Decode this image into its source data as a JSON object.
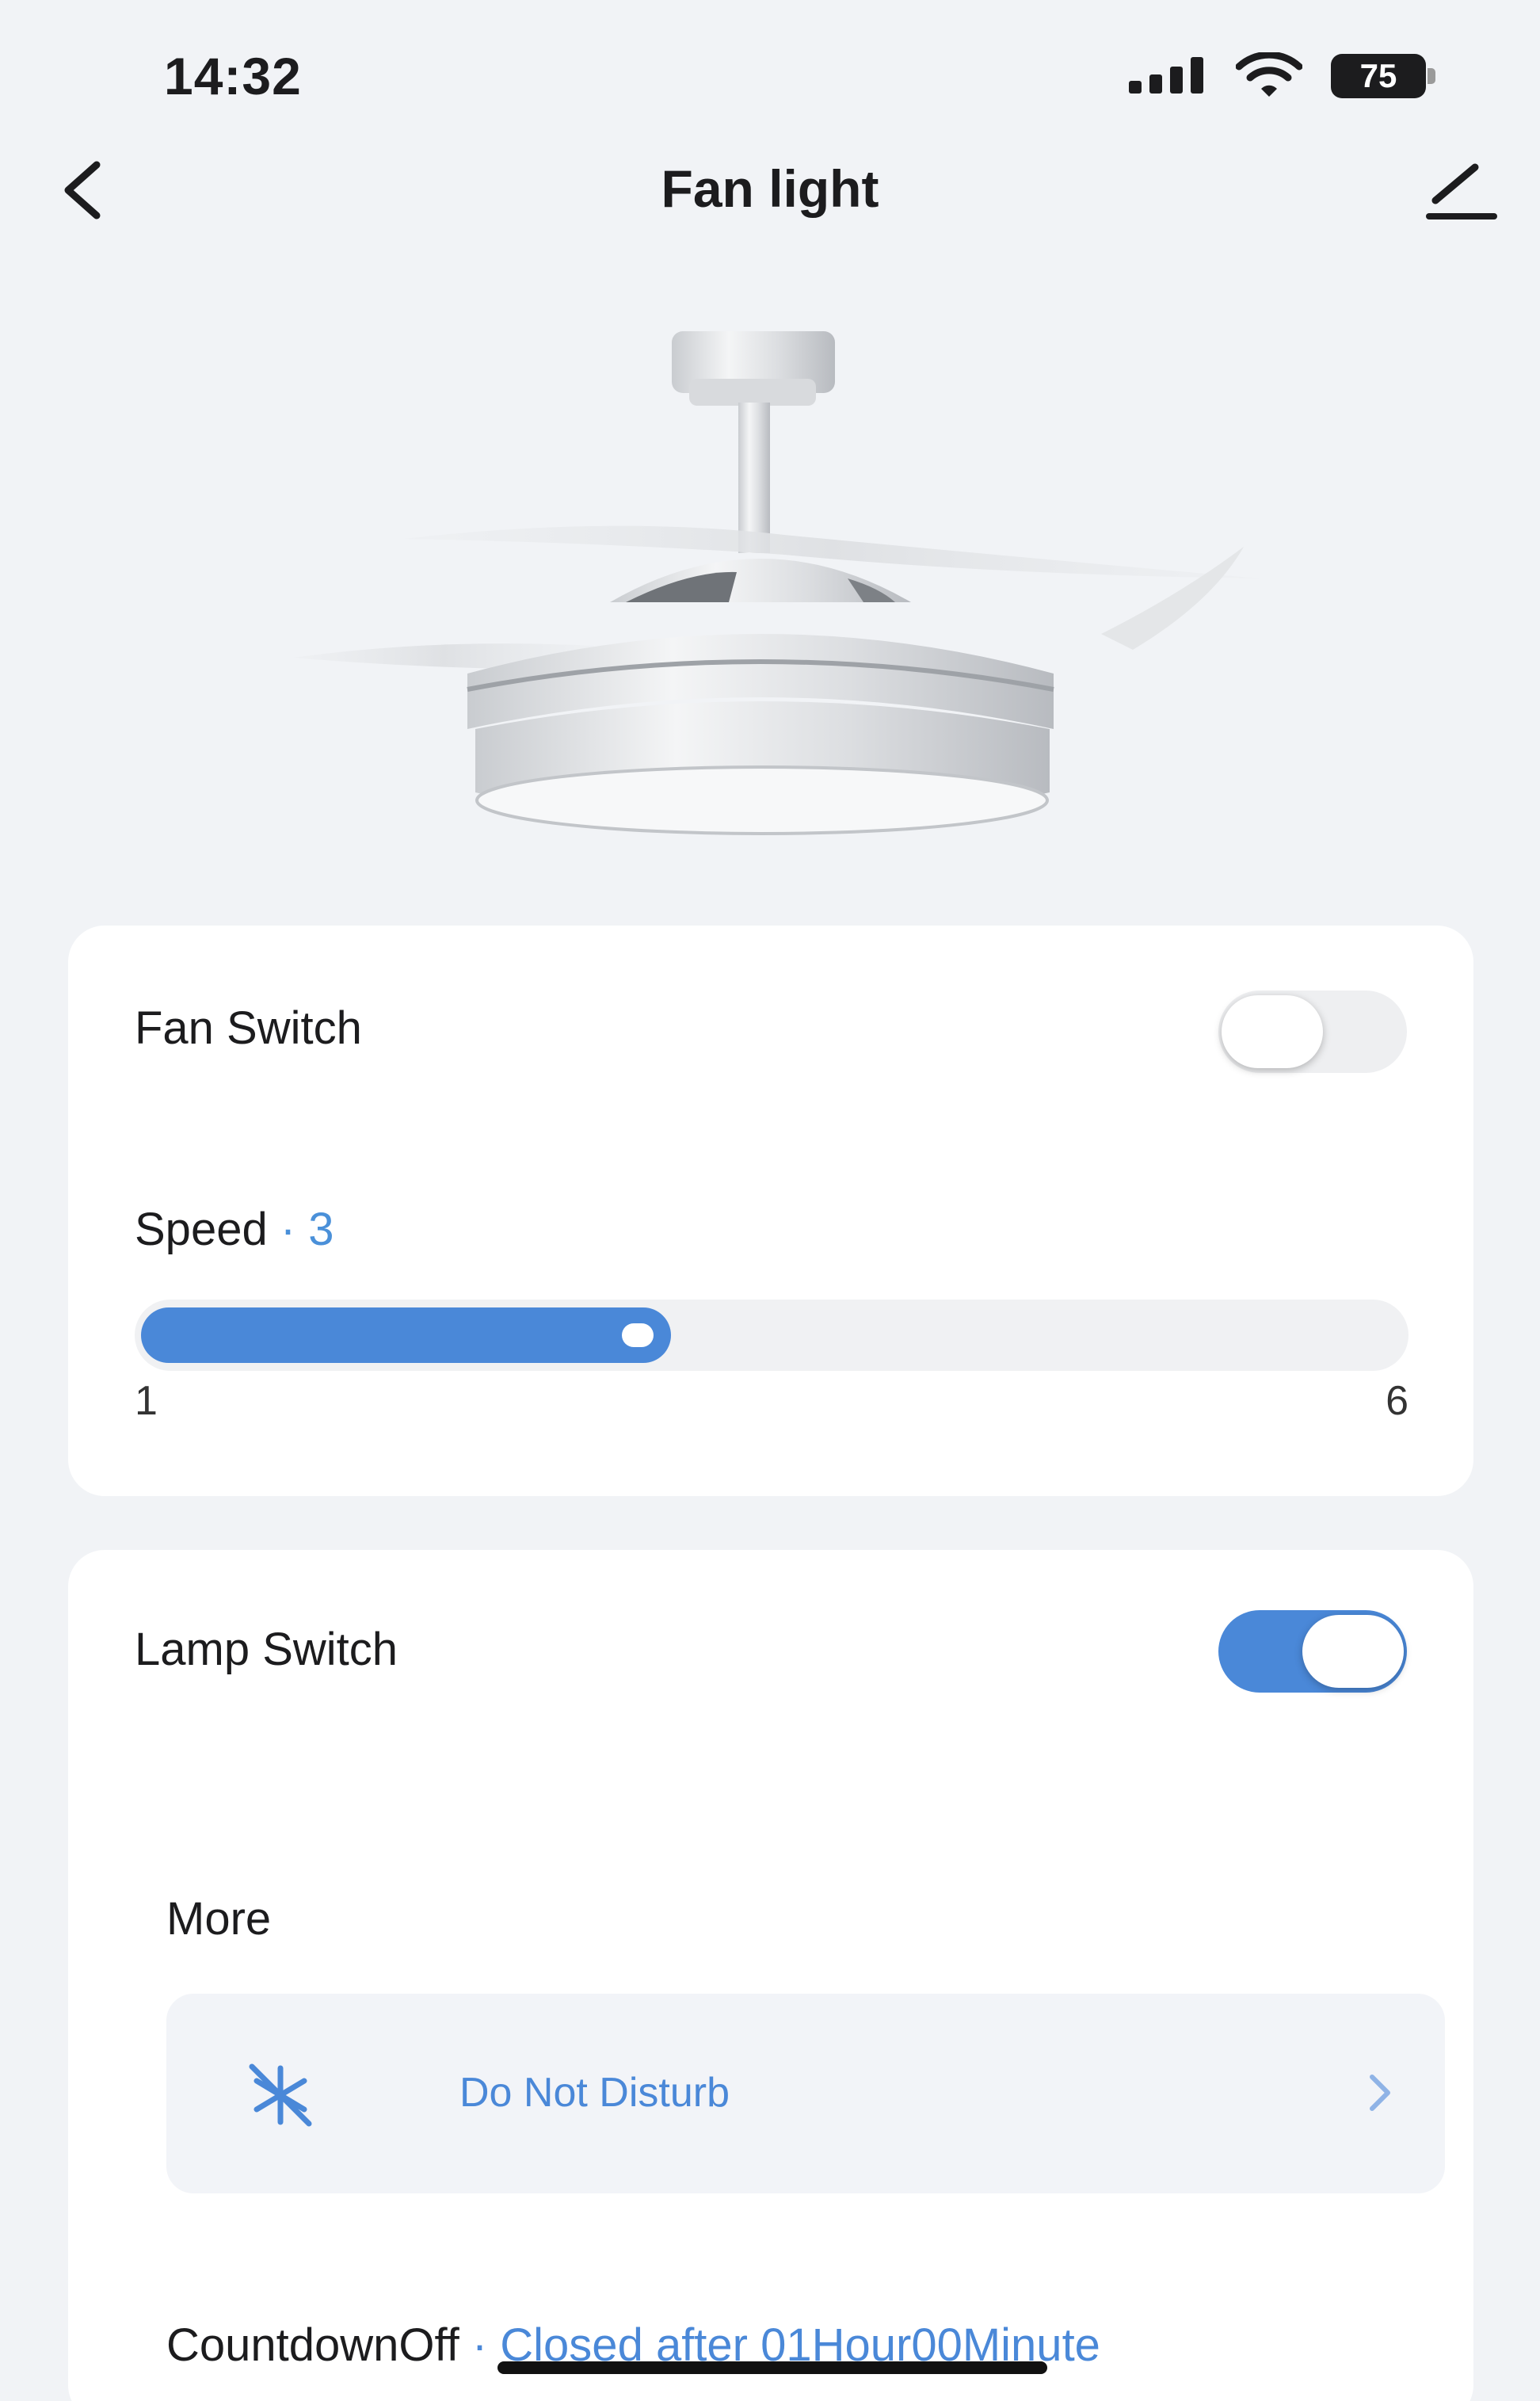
{
  "status_bar": {
    "time": "14:32",
    "battery": "75"
  },
  "nav": {
    "title": "Fan light",
    "back_icon": "chevron-left-icon",
    "edit_icon": "pencil-icon"
  },
  "fan_card": {
    "fan_switch_label": "Fan Switch",
    "fan_switch_on": false,
    "speed_label": "Speed",
    "speed_separator": " · ",
    "speed_value": "3",
    "speed_min": "1",
    "speed_max": "6",
    "speed_fill_fraction": 0.42
  },
  "lamp_card": {
    "lamp_switch_label": "Lamp Switch",
    "lamp_switch_on": true,
    "more_label": "More",
    "dnd_label": "Do Not Disturb",
    "countdown_label": "CountdownOff",
    "countdown_separator": " · ",
    "countdown_value": "Closed after 01Hour00Minute"
  },
  "colors": {
    "accent": "#4a88d8",
    "background": "#f1f3f6",
    "card": "#ffffff"
  }
}
